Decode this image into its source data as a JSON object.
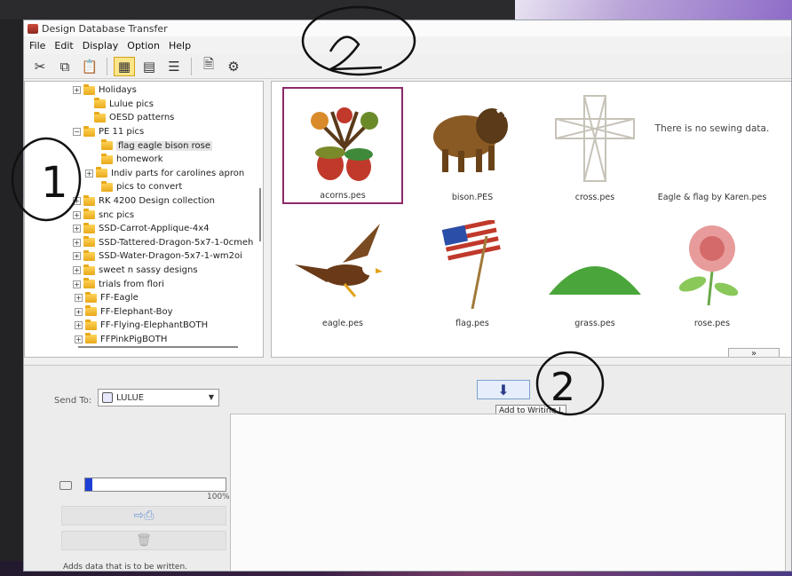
{
  "window": {
    "title": "Design Database Transfer"
  },
  "menu": [
    "File",
    "Edit",
    "Display",
    "Option",
    "Help"
  ],
  "toolbar": {
    "icons": [
      "scissors-icon",
      "copy-icon",
      "paste-icon",
      "large-thumbnail-icon",
      "small-thumbnail-icon",
      "list-view-icon",
      "document-icon",
      "settings-icon"
    ]
  },
  "tree": {
    "items": [
      {
        "label": "Holidays",
        "expander": "+"
      },
      {
        "label": "Lulue pics",
        "expander": ""
      },
      {
        "label": "OESD patterns",
        "expander": ""
      },
      {
        "label": "PE 11 pics",
        "expander": "−"
      },
      {
        "label": "flag eagle bison rose",
        "expander": "",
        "selected": true
      },
      {
        "label": "homework",
        "expander": ""
      },
      {
        "label": "Indiv parts for carolines apron",
        "expander": "+"
      },
      {
        "label": "pics to convert",
        "expander": ""
      },
      {
        "label": "RK 4200 Design collection",
        "expander": "+"
      },
      {
        "label": "snc pics",
        "expander": "+"
      },
      {
        "label": "SSD-Carrot-Applique-4x4",
        "expander": "+"
      },
      {
        "label": "SSD-Tattered-Dragon-5x7-1-0cmeh",
        "expander": "+"
      },
      {
        "label": "SSD-Water-Dragon-5x7-1-wm2oi",
        "expander": "+"
      },
      {
        "label": "sweet n sassy designs",
        "expander": "+"
      },
      {
        "label": "trials from flori",
        "expander": "+"
      },
      {
        "label": "FF-Eagle",
        "expander": "+"
      },
      {
        "label": "FF-Elephant-Boy",
        "expander": "+"
      },
      {
        "label": "FF-Flying-ElephantBOTH",
        "expander": "+"
      },
      {
        "label": "FFPinkPigBOTH",
        "expander": "+"
      }
    ]
  },
  "gallery": {
    "items": [
      {
        "label": "acorns.pes",
        "art": "acorns"
      },
      {
        "label": "bison.PES",
        "art": "bison"
      },
      {
        "label": "cross.pes",
        "art": "cross"
      },
      {
        "label": "Eagle & flag by Karen.pes",
        "art": "none",
        "no_data": "There is no sewing data."
      },
      {
        "label": "eagle.pes",
        "art": "eagle"
      },
      {
        "label": "flag.pes",
        "art": "flag"
      },
      {
        "label": "grass.pes",
        "art": "grass"
      },
      {
        "label": "rose.pes",
        "art": "rose"
      }
    ],
    "expand_glyph": "»"
  },
  "send": {
    "label": "Send To:",
    "target": "LULUE"
  },
  "add_button": {
    "glyph": "⬇",
    "tooltip": "Add to Writing L"
  },
  "progress": {
    "percent": 5,
    "label": "100%"
  },
  "status": "Adds data that is to be written.",
  "annotations": {
    "one": "1",
    "two": "2"
  }
}
